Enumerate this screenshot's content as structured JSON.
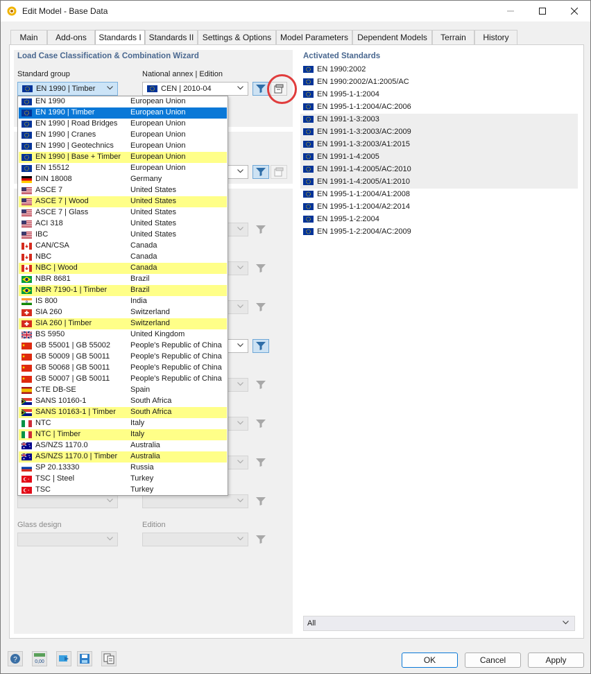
{
  "window": {
    "title": "Edit Model - Base Data",
    "app_icon": "rfem-icon",
    "controls": [
      "minimize-icon",
      "maximize-icon",
      "close-icon"
    ]
  },
  "tabs": [
    {
      "label": "Main",
      "active": false
    },
    {
      "label": "Add-ons",
      "active": false
    },
    {
      "label": "Standards I",
      "active": true
    },
    {
      "label": "Standards II",
      "active": false
    },
    {
      "label": "Settings & Options",
      "active": false
    },
    {
      "label": "Model Parameters",
      "active": false
    },
    {
      "label": "Dependent Models",
      "active": false
    },
    {
      "label": "Terrain",
      "active": false
    },
    {
      "label": "History",
      "active": false
    }
  ],
  "left": {
    "section_title": "Load Case Classification & Combination Wizard",
    "standard_group_label": "Standard group",
    "standard_group_value": "EN 1990 | Timber",
    "national_annex_label": "National annex | Edition",
    "national_annex_value": "CEN | 2010-04",
    "glass_design_label": "Glass design",
    "edition_label": "Edition"
  },
  "dropdown": {
    "selected": "EN 1990 | Timber",
    "items": [
      {
        "name": "EN 1990",
        "country": "European Union",
        "flag": "eu",
        "hl": false
      },
      {
        "name": "EN 1990 | Timber",
        "country": "European Union",
        "flag": "eu",
        "hl": false,
        "selected": true
      },
      {
        "name": "EN 1990 | Road Bridges",
        "country": "European Union",
        "flag": "eu",
        "hl": false
      },
      {
        "name": "EN 1990 | Cranes",
        "country": "European Union",
        "flag": "eu",
        "hl": false
      },
      {
        "name": "EN 1990 | Geotechnics",
        "country": "European Union",
        "flag": "eu",
        "hl": false
      },
      {
        "name": "EN 1990 | Base + Timber",
        "country": "European Union",
        "flag": "eu",
        "hl": true
      },
      {
        "name": "EN 15512",
        "country": "European Union",
        "flag": "eu",
        "hl": false
      },
      {
        "name": "DIN 18008",
        "country": "Germany",
        "flag": "de",
        "hl": false
      },
      {
        "name": "ASCE 7",
        "country": "United States",
        "flag": "us",
        "hl": false
      },
      {
        "name": "ASCE 7 | Wood",
        "country": "United States",
        "flag": "us",
        "hl": true
      },
      {
        "name": "ASCE 7 | Glass",
        "country": "United States",
        "flag": "us",
        "hl": false
      },
      {
        "name": "ACI 318",
        "country": "United States",
        "flag": "us",
        "hl": false
      },
      {
        "name": "IBC",
        "country": "United States",
        "flag": "us",
        "hl": false
      },
      {
        "name": "CAN/CSA",
        "country": "Canada",
        "flag": "ca",
        "hl": false
      },
      {
        "name": "NBC",
        "country": "Canada",
        "flag": "ca",
        "hl": false
      },
      {
        "name": "NBC | Wood",
        "country": "Canada",
        "flag": "ca",
        "hl": true
      },
      {
        "name": "NBR 8681",
        "country": "Brazil",
        "flag": "br",
        "hl": false
      },
      {
        "name": "NBR 7190-1 | Timber",
        "country": "Brazil",
        "flag": "br",
        "hl": true
      },
      {
        "name": "IS 800",
        "country": "India",
        "flag": "in",
        "hl": false
      },
      {
        "name": "SIA 260",
        "country": "Switzerland",
        "flag": "ch",
        "hl": false
      },
      {
        "name": "SIA 260 | Timber",
        "country": "Switzerland",
        "flag": "ch",
        "hl": true
      },
      {
        "name": "BS 5950",
        "country": "United Kingdom",
        "flag": "gb",
        "hl": false
      },
      {
        "name": "GB 55001 | GB 55002",
        "country": "People's Republic of China",
        "flag": "cn",
        "hl": false
      },
      {
        "name": "GB 50009 | GB 50011",
        "country": "People's Republic of China",
        "flag": "cn",
        "hl": false
      },
      {
        "name": "GB 50068 | GB 50011",
        "country": "People's Republic of China",
        "flag": "cn",
        "hl": false
      },
      {
        "name": "GB 50007 | GB 50011",
        "country": "People's Republic of China",
        "flag": "cn",
        "hl": false
      },
      {
        "name": "CTE DB-SE",
        "country": "Spain",
        "flag": "es",
        "hl": false
      },
      {
        "name": "SANS 10160-1",
        "country": "South Africa",
        "flag": "za",
        "hl": false
      },
      {
        "name": "SANS 10163-1 | Timber",
        "country": "South Africa",
        "flag": "za",
        "hl": true
      },
      {
        "name": "NTC",
        "country": "Italy",
        "flag": "it",
        "hl": false
      },
      {
        "name": "NTC | Timber",
        "country": "Italy",
        "flag": "it",
        "hl": true
      },
      {
        "name": "AS/NZS 1170.0",
        "country": "Australia",
        "flag": "au",
        "hl": false
      },
      {
        "name": "AS/NZS 1170.0 | Timber",
        "country": "Australia",
        "flag": "au",
        "hl": true
      },
      {
        "name": "SP 20.13330",
        "country": "Russia",
        "flag": "ru",
        "hl": false
      },
      {
        "name": "TSC | Steel",
        "country": "Turkey",
        "flag": "tr",
        "hl": false
      },
      {
        "name": "TSC",
        "country": "Turkey",
        "flag": "tr",
        "hl": false
      }
    ]
  },
  "right": {
    "section_title": "Activated Standards",
    "standards": [
      {
        "name": "EN 1990:2002",
        "shaded": false
      },
      {
        "name": "EN 1990:2002/A1:2005/AC",
        "shaded": false
      },
      {
        "name": "EN 1995-1-1:2004",
        "shaded": false
      },
      {
        "name": "EN 1995-1-1:2004/AC:2006",
        "shaded": false
      },
      {
        "name": "EN 1991-1-3:2003",
        "shaded": true
      },
      {
        "name": "EN 1991-1-3:2003/AC:2009",
        "shaded": true
      },
      {
        "name": "EN 1991-1-3:2003/A1:2015",
        "shaded": true
      },
      {
        "name": "EN 1991-1-4:2005",
        "shaded": true
      },
      {
        "name": "EN 1991-1-4:2005/AC:2010",
        "shaded": true
      },
      {
        "name": "EN 1991-1-4:2005/A1:2010",
        "shaded": true
      },
      {
        "name": "EN 1995-1-1:2004/A1:2008",
        "shaded": false
      },
      {
        "name": "EN 1995-1-1:2004/A2:2014",
        "shaded": false
      },
      {
        "name": "EN 1995-1-2:2004",
        "shaded": false
      },
      {
        "name": "EN 1995-1-2:2004/AC:2009",
        "shaded": false
      }
    ],
    "filter_value": "All"
  },
  "footer": {
    "ok": "OK",
    "cancel": "Cancel",
    "apply": "Apply",
    "tool_icons": [
      "help-icon",
      "units-icon",
      "import-icon",
      "save-icon",
      "copy-icon"
    ],
    "units_text": "0,00"
  },
  "colors": {
    "accent": "#0a78d7",
    "highlight": "#ffff88",
    "section_title": "#4a6890",
    "callout": "#e03c3c"
  }
}
